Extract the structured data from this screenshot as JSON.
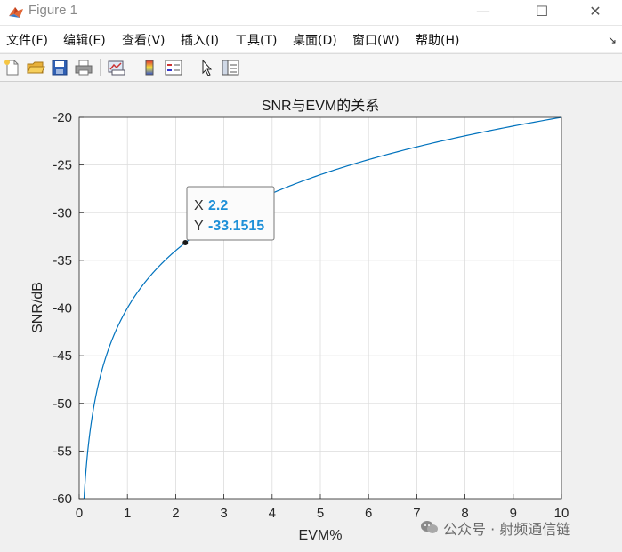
{
  "window": {
    "title": "Figure 1",
    "minimize": "—",
    "maximize": "☐",
    "close": "✕"
  },
  "menu": {
    "items": [
      "文件(F)",
      "编辑(E)",
      "查看(V)",
      "插入(I)",
      "工具(T)",
      "桌面(D)",
      "窗口(W)",
      "帮助(H)"
    ],
    "corner": "↘"
  },
  "toolbar": {
    "icons": [
      "new-file-icon",
      "open-folder-icon",
      "save-icon",
      "print-icon",
      "link-plot-icon",
      "colorbar-icon",
      "legend-icon",
      "pointer-icon",
      "property-editor-icon"
    ]
  },
  "chart_data": {
    "type": "line",
    "title": "SNR与EVM的关系",
    "xlabel": "EVM%",
    "ylabel": "SNR/dB",
    "xlim": [
      0,
      10
    ],
    "ylim": [
      -60,
      -20
    ],
    "xticks": [
      "0",
      "1",
      "2",
      "3",
      "4",
      "5",
      "6",
      "7",
      "8",
      "9",
      "10"
    ],
    "yticks": [
      "-20",
      "-25",
      "-30",
      "-35",
      "-40",
      "-45",
      "-50",
      "-55",
      "-60"
    ],
    "grid": true,
    "series": [
      {
        "formula": "y = 20*log10(x/100)",
        "color": "#0072BD",
        "x": [
          0.1,
          0.15,
          0.2,
          0.3,
          0.4,
          0.5,
          0.7,
          1.0,
          1.5,
          2.0,
          2.2,
          3.0,
          4.0,
          5.0,
          6.0,
          7.0,
          8.0,
          9.0,
          10.0
        ],
        "y": [
          -60,
          -56.48,
          -53.98,
          -50.46,
          -47.96,
          -46.02,
          -43.1,
          -40,
          -36.48,
          -33.98,
          -33.15,
          -30.46,
          -27.96,
          -26.02,
          -24.44,
          -23.1,
          -21.94,
          -20.92,
          -20
        ]
      }
    ],
    "datatip": {
      "x": 2.2,
      "y": -33.1515,
      "x_label": "X",
      "y_label": "Y",
      "x_text": "2.2",
      "y_text": "-33.1515"
    }
  },
  "watermark": {
    "text": "公众号 · 射频通信链"
  }
}
